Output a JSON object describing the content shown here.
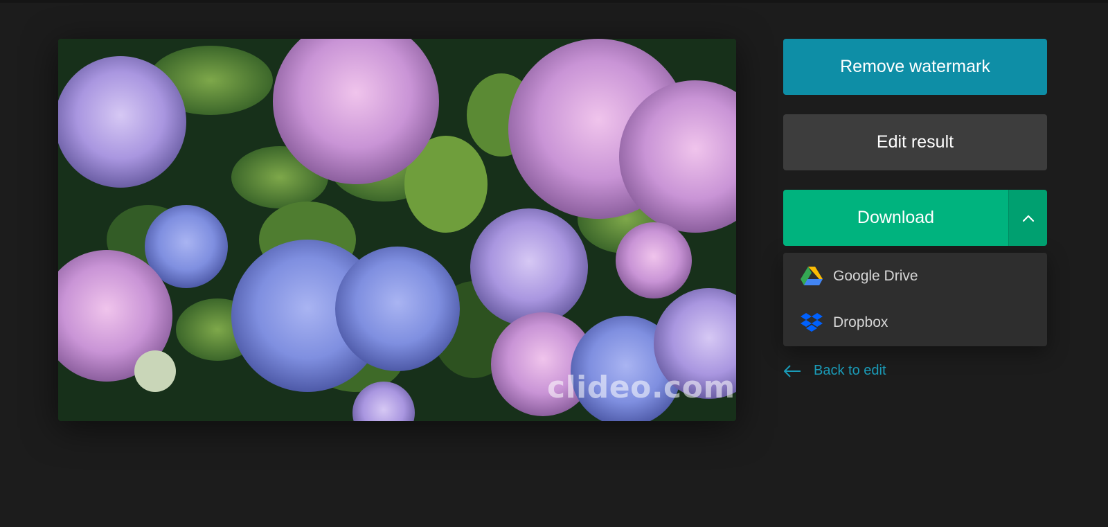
{
  "preview": {
    "watermark_text": "clideo.com"
  },
  "actions": {
    "remove_watermark_label": "Remove watermark",
    "edit_result_label": "Edit result",
    "download_label": "Download",
    "toggle_icon": "chevron-up-icon"
  },
  "download_menu": {
    "items": [
      {
        "label": "Google Drive",
        "icon": "google-drive-icon"
      },
      {
        "label": "Dropbox",
        "icon": "dropbox-icon"
      }
    ]
  },
  "back_link": {
    "label": "Back to edit",
    "icon": "arrow-left-icon"
  },
  "colors": {
    "background": "#1c1c1c",
    "remove_watermark": "#0e8ea6",
    "edit_result": "#3d3d3d",
    "download": "#00b37e",
    "menu_bg": "#2e2e2e",
    "link": "#1a9bb8"
  }
}
